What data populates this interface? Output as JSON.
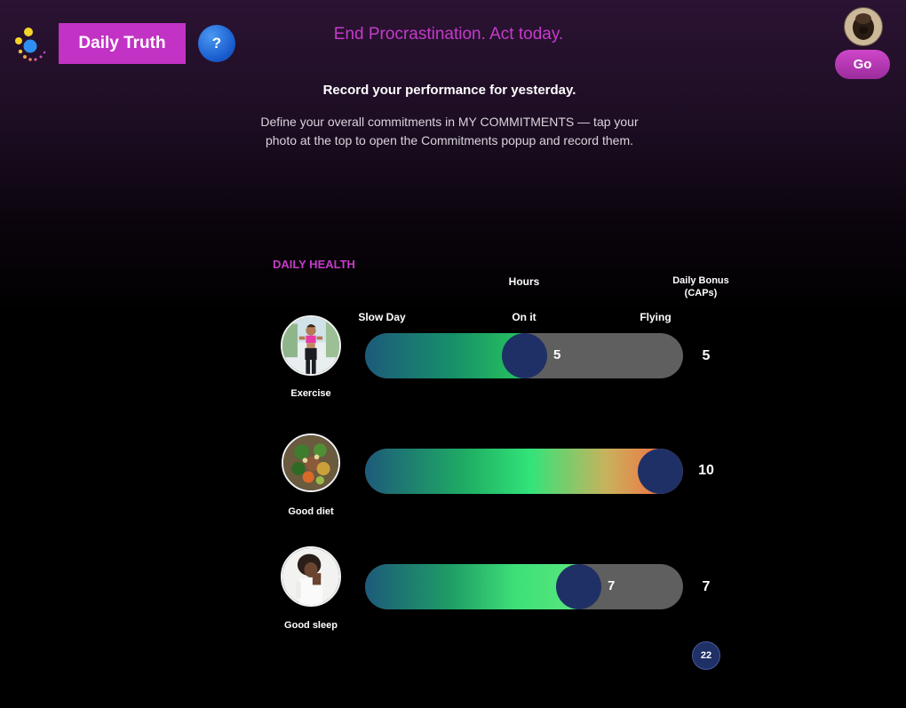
{
  "header": {
    "title_button": "Daily Truth",
    "help_label": "?",
    "tagline": "End Procrastination. Act today.",
    "go_label": "Go"
  },
  "intro": {
    "heading": "Record your performance for yesterday.",
    "body": "Define your overall commitments in MY COMMITMENTS — tap your photo at the top to open the Commitments popup and record them."
  },
  "section": {
    "label": "DAILY HEALTH",
    "hours_header": "Hours",
    "bonus_header_line1": "Daily Bonus",
    "bonus_header_line2": "(CAPs)",
    "scale_low": "Slow Day",
    "scale_mid": "On it",
    "scale_high": "Flying"
  },
  "rows": [
    {
      "label": "Exercise",
      "value": "5",
      "bonus": "5",
      "level": 0.5
    },
    {
      "label": "Good diet",
      "value": "10",
      "bonus": "10",
      "level": 1.0
    },
    {
      "label": "Good sleep",
      "value": "7",
      "bonus": "7",
      "level": 0.7
    }
  ],
  "total": "22",
  "colors": {
    "accent": "#c232c4",
    "knob": "#1f3067",
    "track": "#5f5f5f"
  }
}
